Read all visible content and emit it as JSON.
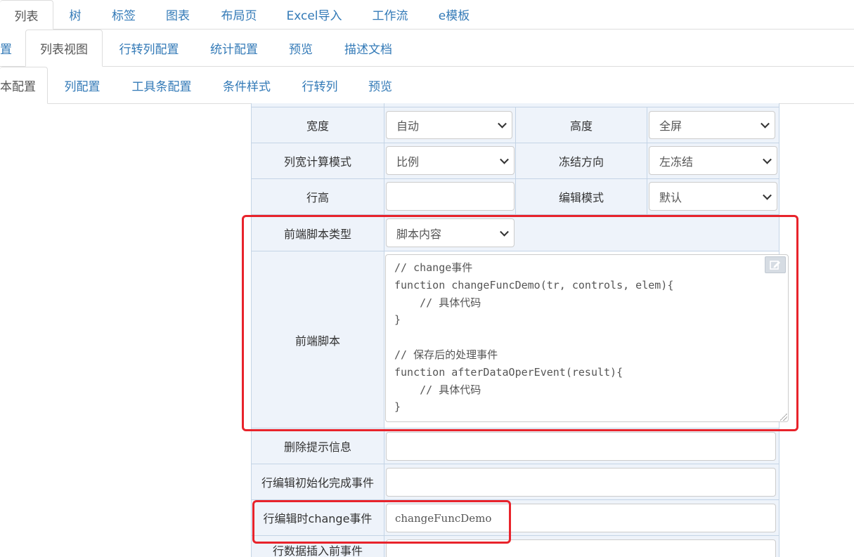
{
  "tabs_level1": [
    {
      "label": "列表",
      "active": true
    },
    {
      "label": "树",
      "active": false
    },
    {
      "label": "标签",
      "active": false
    },
    {
      "label": "图表",
      "active": false
    },
    {
      "label": "布局页",
      "active": false
    },
    {
      "label": "Excel导入",
      "active": false
    },
    {
      "label": "工作流",
      "active": false
    },
    {
      "label": "e模板",
      "active": false
    }
  ],
  "tabs_level2": [
    {
      "label": "置",
      "active": false
    },
    {
      "label": "列表视图",
      "active": true
    },
    {
      "label": "行转列配置",
      "active": false
    },
    {
      "label": "统计配置",
      "active": false
    },
    {
      "label": "预览",
      "active": false
    },
    {
      "label": "描述文档",
      "active": false
    }
  ],
  "tabs_level3": [
    {
      "label": "本配置",
      "active": true
    },
    {
      "label": "列配置",
      "active": false
    },
    {
      "label": "工具条配置",
      "active": false
    },
    {
      "label": "条件样式",
      "active": false
    },
    {
      "label": "行转列",
      "active": false
    },
    {
      "label": "预览",
      "active": false
    }
  ],
  "form": {
    "width_label": "宽度",
    "width_value": "自动",
    "height_label": "高度",
    "height_value": "全屏",
    "colcalc_label": "列宽计算模式",
    "colcalc_value": "比例",
    "freeze_label": "冻结方向",
    "freeze_value": "左冻结",
    "rowheight_label": "行高",
    "rowheight_value": "",
    "editmode_label": "编辑模式",
    "editmode_value": "默认",
    "scripttype_label": "前端脚本类型",
    "scripttype_value": "脚本内容",
    "script_label": "前端脚本",
    "script_lines": [
      "// change事件",
      "function changeFuncDemo(tr, controls, elem){",
      "    // 具体代码",
      "}",
      "",
      "// 保存后的处理事件",
      "function afterDataOperEvent(result){",
      "    // 具体代码",
      "}"
    ],
    "delete_label": "删除提示信息",
    "delete_value": "",
    "rowinit_label": "行编辑初始化完成事件",
    "rowinit_value": "",
    "rowchange_label": "行编辑时change事件",
    "rowchange_value": "changeFuncDemo",
    "rowinsert_label": "行数据插入前事件",
    "rowinsert_value": ""
  },
  "colors": {
    "accent": "#337ab7",
    "highlight": "#e8232b",
    "label_bg": "#eef3fa",
    "border": "#c4d4e6"
  },
  "icons": {
    "edit": "edit-icon"
  }
}
